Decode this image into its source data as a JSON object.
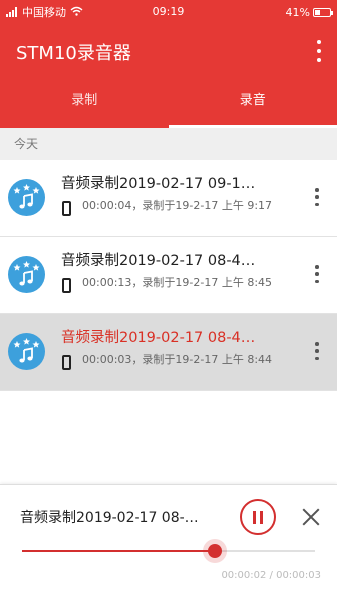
{
  "status_bar": {
    "carrier": "中国移动",
    "time": "09:19",
    "battery": "41%",
    "battery_level": 0.41
  },
  "app": {
    "title": "STM10录音器"
  },
  "tabs": [
    {
      "label": "录制",
      "active": false
    },
    {
      "label": "录音",
      "active": true
    }
  ],
  "section_header": "今天",
  "recordings": [
    {
      "name": "音频录制2019-02-17 09-1…",
      "meta": "00:00:04，录制于19-2-17 上午 9:17",
      "selected": false
    },
    {
      "name": "音频录制2019-02-17 08-4…",
      "meta": "00:00:13，录制于19-2-17 上午 8:45",
      "selected": false
    },
    {
      "name": "音频录制2019-02-17 08-4…",
      "meta": "00:00:03，录制于19-2-17 上午 8:44",
      "selected": true
    }
  ],
  "player": {
    "title": "音频录制2019-02-17 08-…",
    "progress": 0.66,
    "time": "00:00:02 / 00:00:03"
  },
  "colors": {
    "primary": "#e53935",
    "accent": "#d32f2f",
    "avatar": "#3da0dc"
  },
  "icons": {
    "more": "vertical-dots-icon",
    "phone": "phone-icon",
    "pause": "pause-icon",
    "close": "close-icon",
    "music": "music-note-icon"
  }
}
